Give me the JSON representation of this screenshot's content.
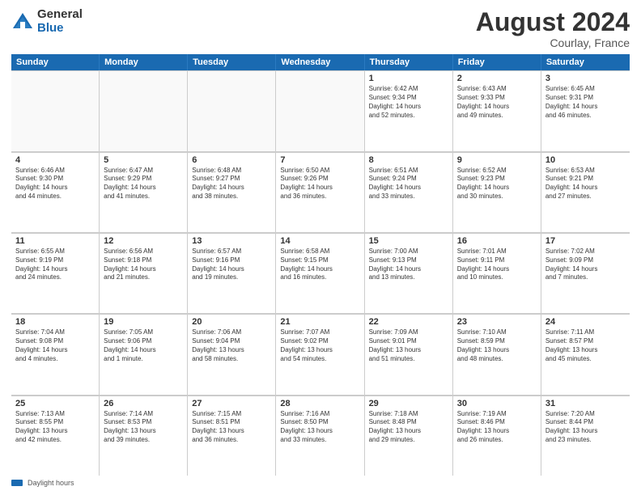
{
  "logo": {
    "general": "General",
    "blue": "Blue"
  },
  "title": {
    "month": "August 2024",
    "location": "Courlay, France"
  },
  "weekdays": [
    "Sunday",
    "Monday",
    "Tuesday",
    "Wednesday",
    "Thursday",
    "Friday",
    "Saturday"
  ],
  "legend": {
    "icon": "bar-icon",
    "label": "Daylight hours"
  },
  "weeks": [
    [
      {
        "day": "",
        "info": "",
        "empty": true
      },
      {
        "day": "",
        "info": "",
        "empty": true
      },
      {
        "day": "",
        "info": "",
        "empty": true
      },
      {
        "day": "",
        "info": "",
        "empty": true
      },
      {
        "day": "1",
        "info": "Sunrise: 6:42 AM\nSunset: 9:34 PM\nDaylight: 14 hours\nand 52 minutes.",
        "empty": false
      },
      {
        "day": "2",
        "info": "Sunrise: 6:43 AM\nSunset: 9:33 PM\nDaylight: 14 hours\nand 49 minutes.",
        "empty": false
      },
      {
        "day": "3",
        "info": "Sunrise: 6:45 AM\nSunset: 9:31 PM\nDaylight: 14 hours\nand 46 minutes.",
        "empty": false
      }
    ],
    [
      {
        "day": "4",
        "info": "Sunrise: 6:46 AM\nSunset: 9:30 PM\nDaylight: 14 hours\nand 44 minutes.",
        "empty": false
      },
      {
        "day": "5",
        "info": "Sunrise: 6:47 AM\nSunset: 9:29 PM\nDaylight: 14 hours\nand 41 minutes.",
        "empty": false
      },
      {
        "day": "6",
        "info": "Sunrise: 6:48 AM\nSunset: 9:27 PM\nDaylight: 14 hours\nand 38 minutes.",
        "empty": false
      },
      {
        "day": "7",
        "info": "Sunrise: 6:50 AM\nSunset: 9:26 PM\nDaylight: 14 hours\nand 36 minutes.",
        "empty": false
      },
      {
        "day": "8",
        "info": "Sunrise: 6:51 AM\nSunset: 9:24 PM\nDaylight: 14 hours\nand 33 minutes.",
        "empty": false
      },
      {
        "day": "9",
        "info": "Sunrise: 6:52 AM\nSunset: 9:23 PM\nDaylight: 14 hours\nand 30 minutes.",
        "empty": false
      },
      {
        "day": "10",
        "info": "Sunrise: 6:53 AM\nSunset: 9:21 PM\nDaylight: 14 hours\nand 27 minutes.",
        "empty": false
      }
    ],
    [
      {
        "day": "11",
        "info": "Sunrise: 6:55 AM\nSunset: 9:19 PM\nDaylight: 14 hours\nand 24 minutes.",
        "empty": false
      },
      {
        "day": "12",
        "info": "Sunrise: 6:56 AM\nSunset: 9:18 PM\nDaylight: 14 hours\nand 21 minutes.",
        "empty": false
      },
      {
        "day": "13",
        "info": "Sunrise: 6:57 AM\nSunset: 9:16 PM\nDaylight: 14 hours\nand 19 minutes.",
        "empty": false
      },
      {
        "day": "14",
        "info": "Sunrise: 6:58 AM\nSunset: 9:15 PM\nDaylight: 14 hours\nand 16 minutes.",
        "empty": false
      },
      {
        "day": "15",
        "info": "Sunrise: 7:00 AM\nSunset: 9:13 PM\nDaylight: 14 hours\nand 13 minutes.",
        "empty": false
      },
      {
        "day": "16",
        "info": "Sunrise: 7:01 AM\nSunset: 9:11 PM\nDaylight: 14 hours\nand 10 minutes.",
        "empty": false
      },
      {
        "day": "17",
        "info": "Sunrise: 7:02 AM\nSunset: 9:09 PM\nDaylight: 14 hours\nand 7 minutes.",
        "empty": false
      }
    ],
    [
      {
        "day": "18",
        "info": "Sunrise: 7:04 AM\nSunset: 9:08 PM\nDaylight: 14 hours\nand 4 minutes.",
        "empty": false
      },
      {
        "day": "19",
        "info": "Sunrise: 7:05 AM\nSunset: 9:06 PM\nDaylight: 14 hours\nand 1 minute.",
        "empty": false
      },
      {
        "day": "20",
        "info": "Sunrise: 7:06 AM\nSunset: 9:04 PM\nDaylight: 13 hours\nand 58 minutes.",
        "empty": false
      },
      {
        "day": "21",
        "info": "Sunrise: 7:07 AM\nSunset: 9:02 PM\nDaylight: 13 hours\nand 54 minutes.",
        "empty": false
      },
      {
        "day": "22",
        "info": "Sunrise: 7:09 AM\nSunset: 9:01 PM\nDaylight: 13 hours\nand 51 minutes.",
        "empty": false
      },
      {
        "day": "23",
        "info": "Sunrise: 7:10 AM\nSunset: 8:59 PM\nDaylight: 13 hours\nand 48 minutes.",
        "empty": false
      },
      {
        "day": "24",
        "info": "Sunrise: 7:11 AM\nSunset: 8:57 PM\nDaylight: 13 hours\nand 45 minutes.",
        "empty": false
      }
    ],
    [
      {
        "day": "25",
        "info": "Sunrise: 7:13 AM\nSunset: 8:55 PM\nDaylight: 13 hours\nand 42 minutes.",
        "empty": false
      },
      {
        "day": "26",
        "info": "Sunrise: 7:14 AM\nSunset: 8:53 PM\nDaylight: 13 hours\nand 39 minutes.",
        "empty": false
      },
      {
        "day": "27",
        "info": "Sunrise: 7:15 AM\nSunset: 8:51 PM\nDaylight: 13 hours\nand 36 minutes.",
        "empty": false
      },
      {
        "day": "28",
        "info": "Sunrise: 7:16 AM\nSunset: 8:50 PM\nDaylight: 13 hours\nand 33 minutes.",
        "empty": false
      },
      {
        "day": "29",
        "info": "Sunrise: 7:18 AM\nSunset: 8:48 PM\nDaylight: 13 hours\nand 29 minutes.",
        "empty": false
      },
      {
        "day": "30",
        "info": "Sunrise: 7:19 AM\nSunset: 8:46 PM\nDaylight: 13 hours\nand 26 minutes.",
        "empty": false
      },
      {
        "day": "31",
        "info": "Sunrise: 7:20 AM\nSunset: 8:44 PM\nDaylight: 13 hours\nand 23 minutes.",
        "empty": false
      }
    ]
  ]
}
